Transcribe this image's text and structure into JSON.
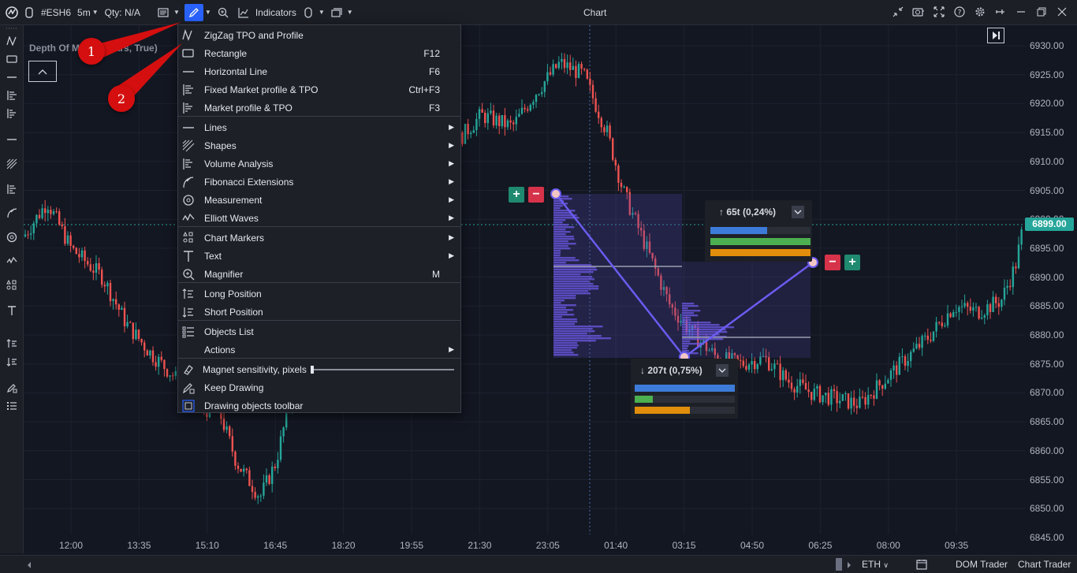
{
  "toolbar": {
    "symbol": "#ESH6",
    "timeframe": "5m",
    "qty": "Qty: N/A",
    "indicators": "Indicators",
    "title": "Chart"
  },
  "indicator_overlay": {
    "label": "Depth Of Market (Bars, True)"
  },
  "menu": {
    "items": [
      {
        "label": "ZigZag TPO and Profile",
        "shortcut": "",
        "submenu": false,
        "icon": "zigzag-icon"
      },
      {
        "label": "Rectangle",
        "shortcut": "F12",
        "submenu": false,
        "icon": "rectangle-icon"
      },
      {
        "label": "Horizontal Line",
        "shortcut": "F6",
        "submenu": false,
        "icon": "horizontal-line-icon"
      },
      {
        "label": "Fixed Market profile & TPO",
        "shortcut": "Ctrl+F3",
        "submenu": false,
        "icon": "fixed-profile-icon"
      },
      {
        "label": "Market profile & TPO",
        "shortcut": "F3",
        "submenu": false,
        "icon": "market-profile-icon"
      },
      {
        "label": "Lines",
        "shortcut": "",
        "submenu": true,
        "icon": "lines-icon"
      },
      {
        "label": "Shapes",
        "shortcut": "",
        "submenu": true,
        "icon": "shapes-icon"
      },
      {
        "label": "Volume Analysis",
        "shortcut": "",
        "submenu": true,
        "icon": "volume-analysis-icon"
      },
      {
        "label": "Fibonacci Extensions",
        "shortcut": "",
        "submenu": true,
        "icon": "fibonacci-icon"
      },
      {
        "label": "Measurement",
        "shortcut": "",
        "submenu": true,
        "icon": "measurement-icon"
      },
      {
        "label": "Elliott Waves",
        "shortcut": "",
        "submenu": true,
        "icon": "elliott-waves-icon"
      },
      {
        "label": "Chart Markers",
        "shortcut": "",
        "submenu": true,
        "icon": "chart-markers-icon"
      },
      {
        "label": "Text",
        "shortcut": "",
        "submenu": true,
        "icon": "text-icon"
      },
      {
        "label": "Magnifier",
        "shortcut": "M",
        "submenu": false,
        "icon": "magnifier-icon"
      },
      {
        "label": "Long Position",
        "shortcut": "",
        "submenu": false,
        "icon": "long-position-icon"
      },
      {
        "label": "Short Position",
        "shortcut": "",
        "submenu": false,
        "icon": "short-position-icon"
      },
      {
        "label": "Objects List",
        "shortcut": "",
        "submenu": false,
        "icon": "objects-list-icon"
      },
      {
        "label": "Actions",
        "shortcut": "",
        "submenu": true,
        "icon": "actions-icon"
      },
      {
        "label": "Magnet sensitivity, pixels",
        "shortcut": "",
        "submenu": false,
        "icon": "magnet-icon"
      },
      {
        "label": "Keep Drawing",
        "shortcut": "",
        "submenu": false,
        "icon": "keep-drawing-icon"
      },
      {
        "label": "Drawing objects toolbar",
        "shortcut": "",
        "submenu": false,
        "icon": "drawing-toolbar-icon"
      }
    ],
    "magnet_sensitivity": 0.0
  },
  "callouts": [
    "1",
    "2"
  ],
  "y_axis": {
    "ticks": [
      "6930.00",
      "6925.00",
      "6920.00",
      "6915.00",
      "6910.00",
      "6905.00",
      "6900.00",
      "6895.00",
      "6890.00",
      "6885.00",
      "6880.00",
      "6875.00",
      "6870.00",
      "6865.00",
      "6860.00",
      "6855.00",
      "6850.00",
      "6845.00"
    ],
    "current_price": "6899.00"
  },
  "x_axis": {
    "ticks": [
      "12:00",
      "13:35",
      "15:10",
      "16:45",
      "18:20",
      "19:55",
      "21:30",
      "23:05",
      "01:40",
      "03:15",
      "04:50",
      "06:25",
      "08:00",
      "09:35"
    ]
  },
  "measure_up": {
    "label": "↑ 65t (0,24%)",
    "bars": [
      0.57,
      1.0,
      1.0
    ]
  },
  "measure_down": {
    "label": "↓ 207t (0,75%)",
    "bars": [
      1.0,
      0.18,
      0.55
    ]
  },
  "bottom": {
    "session": "ETH",
    "dom_trader": "DOM Trader",
    "chart_trader": "Chart Trader"
  },
  "colors": {
    "up": "#26a69a",
    "down": "#ef5350",
    "profile": "#5b4fd6",
    "accent": "#2962ff",
    "bar_blue": "#3d7bd9",
    "bar_green": "#4caf50",
    "bar_orange": "#e08e0b"
  }
}
